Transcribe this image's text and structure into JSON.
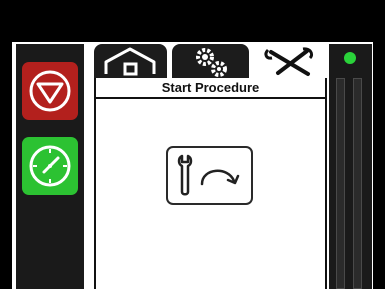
{
  "screen": {
    "title": "Start Procedure",
    "colors": {
      "stop": "#b3201d",
      "start": "#2cc232",
      "status": "#2ad23a",
      "background": "#000000"
    }
  },
  "sidebar": {
    "stop_icon": "stop-icon",
    "start_icon": "start-gauge-icon"
  },
  "tabs": [
    {
      "icon": "home-icon",
      "active": false
    },
    {
      "icon": "settings-gears-icon",
      "active": false
    },
    {
      "icon": "tools-icon",
      "active": true
    }
  ],
  "main": {
    "procedure_icon": "wrench-rotate-icon"
  },
  "status": {
    "indicator": "status-led-icon"
  }
}
